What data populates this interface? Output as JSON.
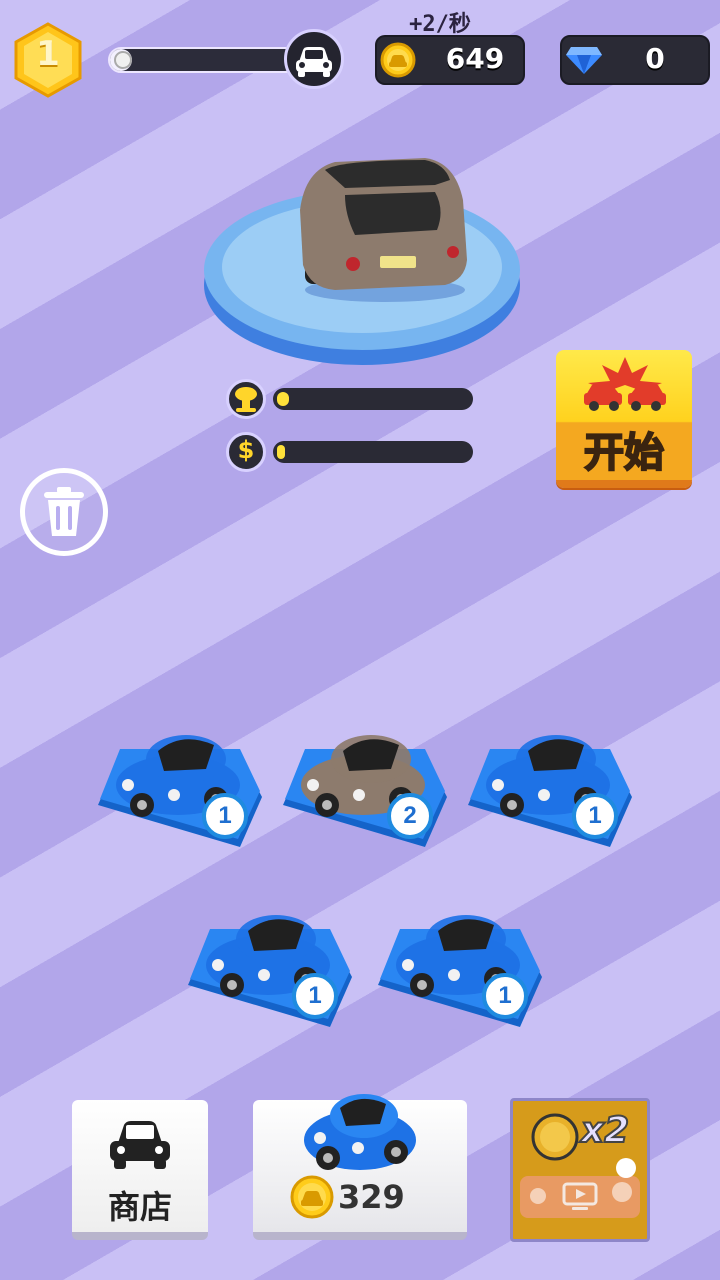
{
  "hud": {
    "level": "1",
    "level_progress": 0.08,
    "income_rate": "+2/秒",
    "coins": "649",
    "gems": "0",
    "icons": [
      "hexagon-level-badge",
      "car-icon",
      "coin-icon",
      "diamond-icon"
    ]
  },
  "showcase": {
    "car_color": "#8d7b6d",
    "power_progress": 0.06,
    "income_progress": 0.02,
    "icons": [
      "explosion-icon",
      "dollar-icon"
    ]
  },
  "start_button": {
    "label": "开始",
    "icon": "car-crash-icon"
  },
  "delete_button": {
    "icon": "trash-icon"
  },
  "garage": {
    "slots": [
      {
        "level": "1",
        "car_color": "#1e72e6"
      },
      {
        "level": "2",
        "car_color": "#8d7b6d"
      },
      {
        "level": "1",
        "car_color": "#1e72e6"
      },
      {
        "level": "1",
        "car_color": "#1e72e6"
      },
      {
        "level": "1",
        "car_color": "#1e72e6"
      }
    ]
  },
  "bottom": {
    "shop_label": "商店",
    "buy_price": "329",
    "boost_label": "x2",
    "icons": [
      "shop-car-icon",
      "coin-icon",
      "video-ad-icon"
    ]
  },
  "colors": {
    "stripe_light": "#c9c0f5",
    "stripe_dark": "#b2a6ea",
    "accent_yellow": "#ffd21e",
    "slot_blue": "#1f8be0"
  }
}
